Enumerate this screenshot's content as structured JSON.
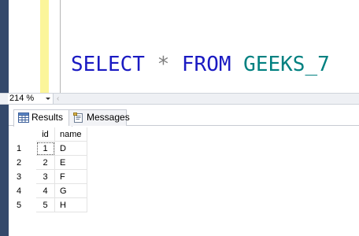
{
  "editor": {
    "query": {
      "kw_select": "SELECT",
      "star": "*",
      "kw_from": "FROM",
      "table": "GEEKS_7"
    }
  },
  "zoom": {
    "value": "214 %"
  },
  "tabs": [
    {
      "label": "Results",
      "icon": "grid-icon",
      "active": true
    },
    {
      "label": "Messages",
      "icon": "messages-icon",
      "active": false
    }
  ],
  "grid": {
    "columns": [
      "id",
      "name"
    ],
    "rows": [
      {
        "num": "1",
        "id": "1",
        "name": "D"
      },
      {
        "num": "2",
        "id": "2",
        "name": "E"
      },
      {
        "num": "3",
        "id": "3",
        "name": "F"
      },
      {
        "num": "4",
        "id": "4",
        "name": "G"
      },
      {
        "num": "5",
        "id": "5",
        "name": "H"
      }
    ]
  },
  "colors": {
    "keyword": "#1a1ac2",
    "identifier": "#008080",
    "operator": "#7f7f7f",
    "change_bar": "#fbf59a",
    "frame": "#34496b"
  }
}
